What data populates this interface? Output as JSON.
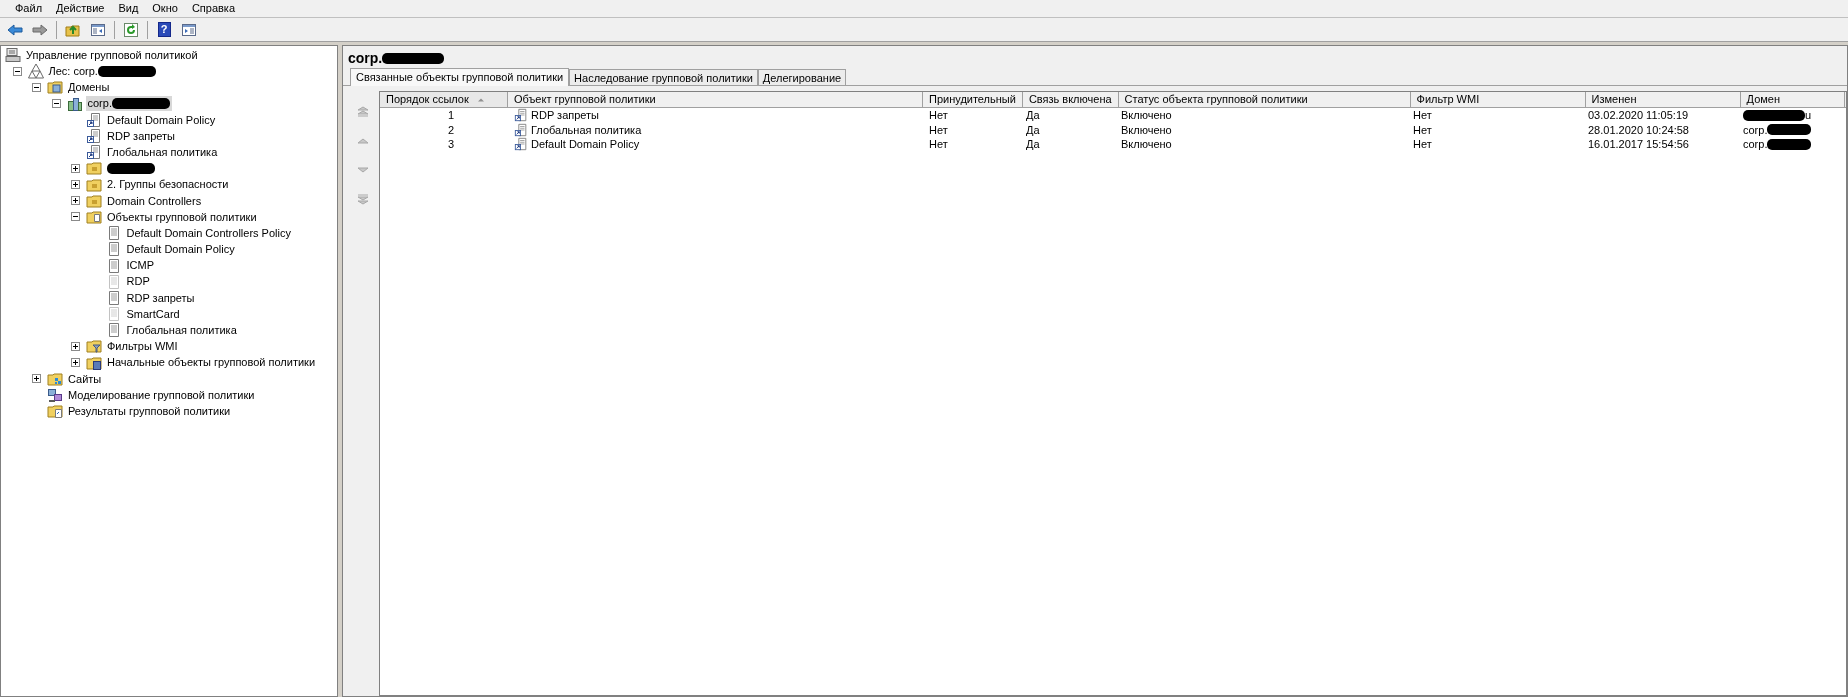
{
  "menu": [
    "Файл",
    "Действие",
    "Вид",
    "Окно",
    "Справка"
  ],
  "toolbar": [
    {
      "kind": "back"
    },
    {
      "kind": "forward"
    },
    {
      "kind": "separator"
    },
    {
      "kind": "up"
    },
    {
      "kind": "tree"
    },
    {
      "kind": "separator"
    },
    {
      "kind": "refresh"
    },
    {
      "kind": "separator"
    },
    {
      "kind": "help",
      "glyph": "?"
    },
    {
      "kind": "pane"
    }
  ],
  "tree": [
    {
      "label": "Управление групповой политикой",
      "kind": "console",
      "selected": false,
      "children": [
        {
          "label": "Лес: corp.",
          "redacted": true,
          "kind": "forest",
          "expanded": true,
          "selected": false,
          "children": [
            {
              "label": "Домены",
              "kind": "domains",
              "expanded": true,
              "selected": false,
              "children": [
                {
                  "label": "corp.",
                  "redacted": true,
                  "kind": "domain",
                  "expanded": true,
                  "selected": true,
                  "children": [
                    {
                      "label": "Default Domain Policy",
                      "kind": "link",
                      "selected": false
                    },
                    {
                      "label": "RDP запреты",
                      "kind": "link",
                      "selected": false
                    },
                    {
                      "label": "Глобальная политика",
                      "kind": "link",
                      "selected": false
                    },
                    {
                      "redacted": true,
                      "kind": "folder",
                      "expanded": false,
                      "selected": false
                    },
                    {
                      "label": "2. Группы безопасности",
                      "kind": "folder",
                      "expanded": false,
                      "selected": false
                    },
                    {
                      "label": "Domain Controllers",
                      "kind": "folder",
                      "expanded": false,
                      "selected": false
                    },
                    {
                      "label": "Объекты групповой политики",
                      "kind": "gpofolder",
                      "expanded": true,
                      "selected": false,
                      "children": [
                        {
                          "label": "Default Domain Controllers Policy",
                          "kind": "gpo",
                          "disabled": false,
                          "selected": false
                        },
                        {
                          "label": "Default Domain Policy",
                          "kind": "gpo",
                          "disabled": false,
                          "selected": false
                        },
                        {
                          "label": "ICMP",
                          "kind": "gpo",
                          "disabled": false,
                          "selected": false
                        },
                        {
                          "label": "RDP",
                          "kind": "gpo",
                          "disabled": true,
                          "selected": false
                        },
                        {
                          "label": "RDP запреты",
                          "kind": "gpo",
                          "disabled": false,
                          "selected": false
                        },
                        {
                          "label": "SmartCard",
                          "kind": "gpo",
                          "disabled": true,
                          "selected": false
                        },
                        {
                          "label": "Глобальная политика",
                          "kind": "gpo",
                          "disabled": false,
                          "selected": false
                        }
                      ]
                    },
                    {
                      "label": "Фильтры WMI",
                      "kind": "wmi",
                      "expanded": false,
                      "selected": false
                    },
                    {
                      "label": "Начальные объекты групповой политики",
                      "kind": "starter",
                      "expanded": false,
                      "selected": false
                    }
                  ]
                }
              ]
            },
            {
              "label": "Сайты",
              "kind": "sites",
              "expanded": false,
              "selected": false
            },
            {
              "label": "Моделирование групповой политики",
              "kind": "modeling",
              "selected": false
            },
            {
              "label": "Результаты групповой политики",
              "kind": "results",
              "selected": false
            }
          ]
        }
      ]
    }
  ],
  "header": {
    "title": "corp.",
    "redacted": true
  },
  "tabs": [
    {
      "label": "Связанные объекты групповой политики",
      "selected": true
    },
    {
      "label": "Наследование групповой политики",
      "selected": false
    },
    {
      "label": "Делегирование",
      "selected": false
    }
  ],
  "order_buttons": [
    {
      "kind": "top",
      "disabled": true
    },
    {
      "kind": "up",
      "disabled": true
    },
    {
      "kind": "down",
      "disabled": true
    },
    {
      "kind": "bottom",
      "disabled": true
    }
  ],
  "table": {
    "columns": [
      {
        "label": "Порядок ссылок",
        "sorted": true
      },
      {
        "label": "Объект групповой политики",
        "sorted": false
      },
      {
        "label": "Принудительный",
        "sorted": false
      },
      {
        "label": "Связь включена",
        "sorted": false
      },
      {
        "label": "Статус объекта групповой политики",
        "sorted": false
      },
      {
        "label": "Фильтр WMI",
        "sorted": false
      },
      {
        "label": "Изменен",
        "sorted": false
      },
      {
        "label": "Домен",
        "sorted": false
      }
    ],
    "rows": [
      {
        "order": "1",
        "gpo": "RDP запреты",
        "enforced": "Нет",
        "link_enabled": "Да",
        "status": "Включено",
        "wmi_filter": "Нет",
        "modified": "03.02.2020 11:05:19",
        "domain": {
          "text": "u",
          "redacted_before": true,
          "redacted_after": false
        }
      },
      {
        "order": "2",
        "gpo": "Глобальная политика",
        "enforced": "Нет",
        "link_enabled": "Да",
        "status": "Включено",
        "wmi_filter": "Нет",
        "modified": "28.01.2020 10:24:58",
        "domain": {
          "text": "corp.",
          "redacted_before": false,
          "redacted_after": true
        }
      },
      {
        "order": "3",
        "gpo": "Default Domain Policy",
        "enforced": "Нет",
        "link_enabled": "Да",
        "status": "Включено",
        "wmi_filter": "Нет",
        "modified": "16.01.2017 15:54:56",
        "domain": {
          "text": "corp.",
          "redacted_before": false,
          "redacted_after": true
        }
      }
    ]
  }
}
